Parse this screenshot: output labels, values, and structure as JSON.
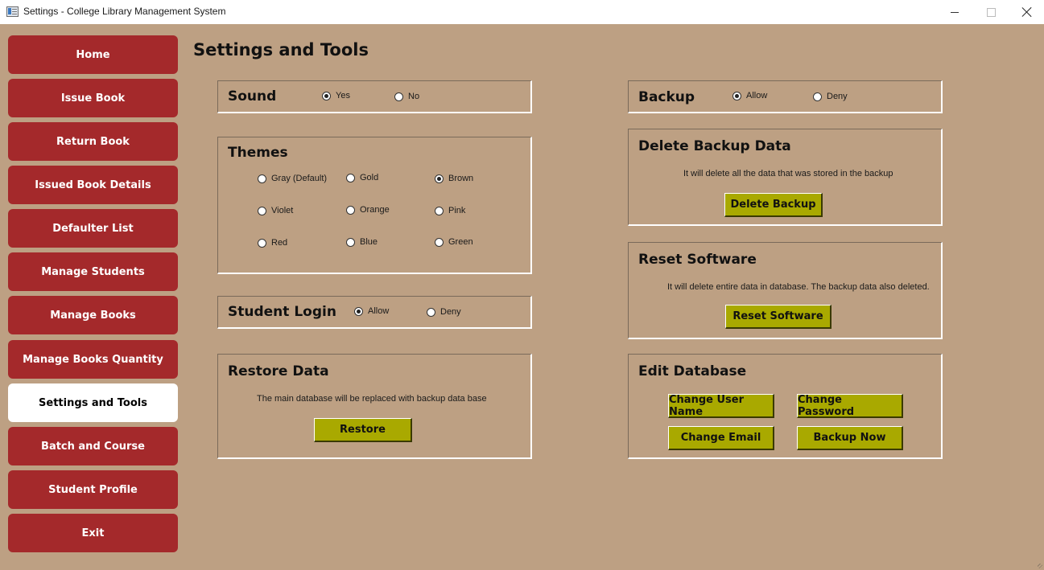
{
  "window": {
    "title": "Settings - College Library Management System"
  },
  "sidebar": {
    "items": [
      {
        "label": "Home"
      },
      {
        "label": "Issue Book"
      },
      {
        "label": "Return Book"
      },
      {
        "label": "Issued Book Details"
      },
      {
        "label": "Defaulter List"
      },
      {
        "label": "Manage Students"
      },
      {
        "label": "Manage Books"
      },
      {
        "label": "Manage Books Quantity"
      },
      {
        "label": "Settings and Tools",
        "active": true
      },
      {
        "label": "Batch and Course"
      },
      {
        "label": "Student Profile"
      },
      {
        "label": "Exit"
      }
    ]
  },
  "page": {
    "title": "Settings and Tools"
  },
  "sound": {
    "title": "Sound",
    "options": [
      "Yes",
      "No"
    ],
    "selected": "Yes"
  },
  "themes": {
    "title": "Themes",
    "options": [
      "Gray (Default)",
      "Gold",
      "Brown",
      "Violet",
      "Orange",
      "Pink",
      "Red",
      "Blue",
      "Green"
    ],
    "selected": "Brown"
  },
  "student_login": {
    "title": "Student Login",
    "options": [
      "Allow",
      "Deny"
    ],
    "selected": "Allow"
  },
  "restore": {
    "title": "Restore Data",
    "description": "The main database will be replaced with backup data base",
    "button": "Restore"
  },
  "backup": {
    "title": "Backup",
    "options": [
      "Allow",
      "Deny"
    ],
    "selected": "Allow"
  },
  "delete_backup": {
    "title": "Delete Backup Data",
    "description": "It will delete all the data that was stored in the backup",
    "button": "Delete Backup"
  },
  "reset": {
    "title": "Reset Software",
    "description": "It will delete entire data in database. The backup data also deleted.",
    "button": "Reset Software"
  },
  "edit_db": {
    "title": "Edit Database",
    "buttons": [
      "Change User Name",
      "Change Password",
      "Change Email",
      "Backup Now"
    ]
  },
  "colors": {
    "background": "#BDA083",
    "nav_button": "#A4292B",
    "nav_active": "#FFFFFF",
    "action_button": "#A9A900"
  }
}
